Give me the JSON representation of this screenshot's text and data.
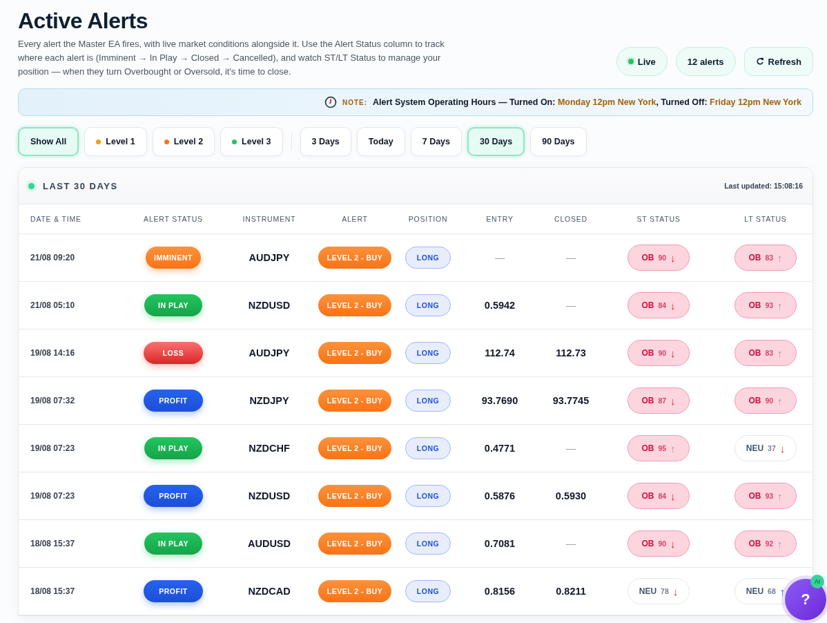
{
  "title": "Active Alerts",
  "description": "Every alert the Master EA fires, with live market conditions alongside it. Use the Alert Status column to track where each alert is (Imminent → In Play → Closed → Cancelled), and watch ST/LT Status to manage your position — when they turn Overbought or Oversold, it's time to close.",
  "header_buttons": [
    {
      "kind": "live",
      "label": "Live"
    },
    {
      "kind": "count",
      "label": "12 alerts"
    },
    {
      "kind": "refresh",
      "label": "Refresh"
    }
  ],
  "note": {
    "tag": "NOTE:",
    "parts": [
      {
        "text": "Alert System Operating Hours — Turned On: ",
        "highlight": false
      },
      {
        "text": "Monday 12pm New York",
        "highlight": true
      },
      {
        "text": ", Turned Off: ",
        "highlight": false
      },
      {
        "text": "Friday 12pm New York",
        "highlight": true
      }
    ]
  },
  "level_filters": [
    {
      "label": "Show All",
      "selected": true
    },
    {
      "label": "Level 1",
      "selected": false,
      "color": "#f59e0b"
    },
    {
      "label": "Level 2",
      "selected": false,
      "color": "#f97316"
    },
    {
      "label": "Level 3",
      "selected": false,
      "color": "#22c55e"
    }
  ],
  "time_filters": [
    {
      "label": "3 Days",
      "selected": false
    },
    {
      "label": "Today",
      "selected": false
    },
    {
      "label": "7 Days",
      "selected": false
    },
    {
      "label": "30 Days",
      "selected": true
    },
    {
      "label": "90 Days",
      "selected": false
    }
  ],
  "table": {
    "title": "LAST 30 DAYS",
    "last_updated": "Last updated: 15:08:16",
    "columns": [
      "DATE & TIME",
      "ALERT STATUS",
      "INSTRUMENT",
      "ALERT",
      "POSITION",
      "ENTRY",
      "CLOSED",
      "ST STATUS",
      "LT STATUS"
    ],
    "rows": [
      {
        "date": "21/08 09:20",
        "status": {
          "kind": "imminent",
          "label": "IMMINENT"
        },
        "instrument": "AUDJPY",
        "alert": "LEVEL 2 - BUY",
        "position": "LONG",
        "entry": "—",
        "closed": "—",
        "st": {
          "kind": "ob",
          "label": "OB",
          "value": "90",
          "arrow": {
            "kind": "down",
            "symbol": "↓"
          }
        },
        "lt": {
          "kind": "ob",
          "label": "OB",
          "value": "83",
          "arrow": {
            "kind": "up",
            "symbol": "↑"
          }
        }
      },
      {
        "date": "21/08 05:10",
        "status": {
          "kind": "inplay",
          "label": "IN PLAY"
        },
        "instrument": "NZDUSD",
        "alert": "LEVEL 2 - BUY",
        "position": "LONG",
        "entry": "0.5942",
        "closed": "—",
        "st": {
          "kind": "ob",
          "label": "OB",
          "value": "84",
          "arrow": {
            "kind": "down",
            "symbol": "↓"
          }
        },
        "lt": {
          "kind": "ob",
          "label": "OB",
          "value": "93",
          "arrow": {
            "kind": "up",
            "symbol": "↑"
          }
        }
      },
      {
        "date": "19/08 14:16",
        "status": {
          "kind": "loss",
          "label": "LOSS"
        },
        "instrument": "AUDJPY",
        "alert": "LEVEL 2 - BUY",
        "position": "LONG",
        "entry": "112.74",
        "closed": "112.73",
        "st": {
          "kind": "ob",
          "label": "OB",
          "value": "90",
          "arrow": {
            "kind": "down",
            "symbol": "↓"
          }
        },
        "lt": {
          "kind": "ob",
          "label": "OB",
          "value": "83",
          "arrow": {
            "kind": "up",
            "symbol": "↑"
          }
        }
      },
      {
        "date": "19/08 07:32",
        "status": {
          "kind": "profit",
          "label": "PROFIT"
        },
        "instrument": "NZDJPY",
        "alert": "LEVEL 2 - BUY",
        "position": "LONG",
        "entry": "93.7690",
        "closed": "93.7745",
        "st": {
          "kind": "ob",
          "label": "OB",
          "value": "87",
          "arrow": {
            "kind": "down",
            "symbol": "↓"
          }
        },
        "lt": {
          "kind": "ob",
          "label": "OB",
          "value": "90",
          "arrow": {
            "kind": "up",
            "symbol": "↑"
          }
        }
      },
      {
        "date": "19/08 07:23",
        "status": {
          "kind": "inplay",
          "label": "IN PLAY"
        },
        "instrument": "NZDCHF",
        "alert": "LEVEL 2 - BUY",
        "position": "LONG",
        "entry": "0.4771",
        "closed": "—",
        "st": {
          "kind": "ob",
          "label": "OB",
          "value": "95",
          "arrow": {
            "kind": "up",
            "symbol": "↑"
          }
        },
        "lt": {
          "kind": "neu",
          "label": "NEU",
          "value": "37",
          "arrow": {
            "kind": "down",
            "symbol": "↓"
          }
        }
      },
      {
        "date": "19/08 07:23",
        "status": {
          "kind": "profit",
          "label": "PROFIT"
        },
        "instrument": "NZDUSD",
        "alert": "LEVEL 2 - BUY",
        "position": "LONG",
        "entry": "0.5876",
        "closed": "0.5930",
        "st": {
          "kind": "ob",
          "label": "OB",
          "value": "84",
          "arrow": {
            "kind": "down",
            "symbol": "↓"
          }
        },
        "lt": {
          "kind": "ob",
          "label": "OB",
          "value": "93",
          "arrow": {
            "kind": "up",
            "symbol": "↑"
          }
        }
      },
      {
        "date": "18/08 15:37",
        "status": {
          "kind": "inplay",
          "label": "IN PLAY"
        },
        "instrument": "AUDUSD",
        "alert": "LEVEL 2 - BUY",
        "position": "LONG",
        "entry": "0.7081",
        "closed": "—",
        "st": {
          "kind": "ob",
          "label": "OB",
          "value": "90",
          "arrow": {
            "kind": "down",
            "symbol": "↓"
          }
        },
        "lt": {
          "kind": "ob",
          "label": "OB",
          "value": "92",
          "arrow": {
            "kind": "up",
            "symbol": "↑"
          }
        }
      },
      {
        "date": "18/08 15:37",
        "status": {
          "kind": "profit",
          "label": "PROFIT"
        },
        "instrument": "NZDCAD",
        "alert": "LEVEL 2 - BUY",
        "position": "LONG",
        "entry": "0.8156",
        "closed": "0.8211",
        "st": {
          "kind": "neu",
          "label": "NEU",
          "value": "78",
          "arrow": {
            "kind": "down",
            "symbol": "↓"
          }
        },
        "lt": {
          "kind": "neu",
          "label": "NEU",
          "value": "68",
          "arrow": {
            "kind": "up",
            "symbol": "↑"
          }
        }
      }
    ]
  },
  "help_button": {
    "label": "?",
    "badge": "AI"
  }
}
